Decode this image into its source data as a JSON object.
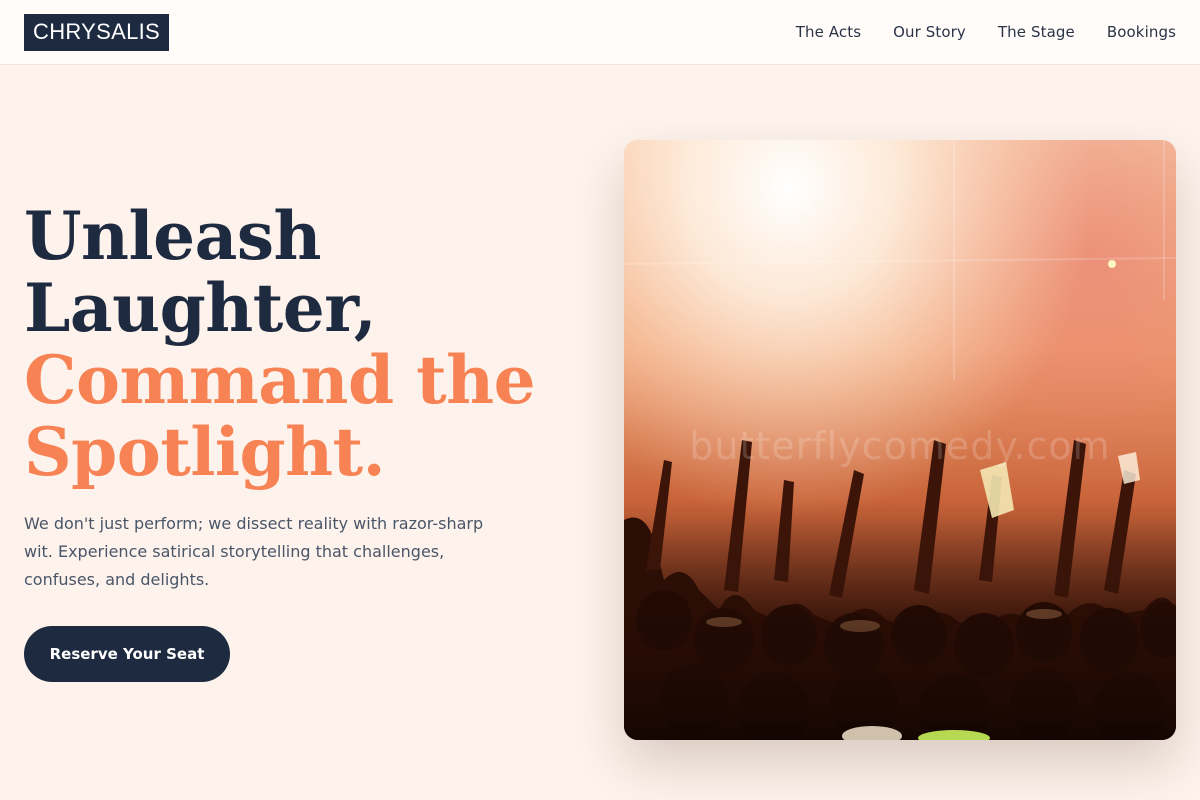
{
  "brand": {
    "logo_text": "CHRYSALIS"
  },
  "nav": {
    "links": [
      {
        "label": "The Acts"
      },
      {
        "label": "Our Story"
      },
      {
        "label": "The Stage"
      },
      {
        "label": "Bookings"
      }
    ]
  },
  "hero": {
    "headline_line1": "Unleash",
    "headline_line2": "Laughter,",
    "headline_accent_line1": "Command the",
    "headline_accent_line2": "Spotlight.",
    "description": "We don't just perform; we dissect reality with razor-sharp wit. Experience satirical storytelling that challenges, confuses, and delights.",
    "cta_label": "Reserve Your Seat",
    "image_watermark": "butterflycomedy.com"
  },
  "colors": {
    "background": "#fdf3ec",
    "navy": "#1e2a40",
    "accent": "#f78355",
    "body_text": "#4a5568"
  }
}
